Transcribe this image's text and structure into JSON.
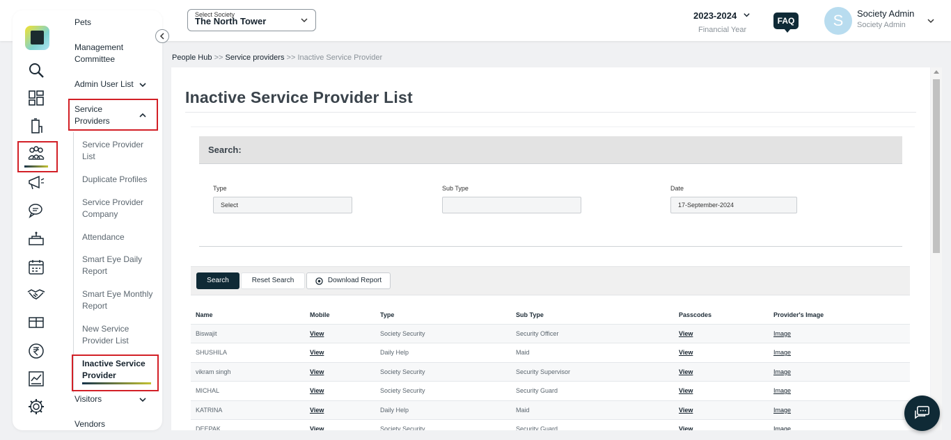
{
  "topbar": {
    "society_label": "Select Society",
    "society_value": "The North Tower",
    "year": "2023-2024",
    "year_caption": "Financial Year",
    "faq": "FAQ",
    "avatar_initial": "S",
    "user_name": "Society Admin",
    "user_role": "Society Admin"
  },
  "sidebar": {
    "rail_icons": [
      "logo",
      "search-icon",
      "dashboard-icon",
      "building-icon",
      "people-hub-icon",
      "megaphone-icon",
      "chat-icon",
      "facility-icon",
      "calendar-icon",
      "handshake-icon",
      "parcel-icon",
      "rupee-icon",
      "report-icon",
      "gear-icon"
    ],
    "items": {
      "pets": "Pets",
      "management": "Management Committee",
      "admin_user_list": "Admin User List",
      "service_providers": "Service Providers",
      "service_provider_list": "Service Provider List",
      "duplicate_profiles": "Duplicate Profiles",
      "service_provider_company": "Service Provider Company",
      "attendance": "Attendance",
      "smart_eye_daily": "Smart Eye Daily Report",
      "smart_eye_monthly": "Smart Eye Monthly Report",
      "new_service_provider": "New Service Provider List",
      "inactive_service_provider": "Inactive Service Provider",
      "visitors": "Visitors",
      "vendors": "Vendors"
    }
  },
  "breadcrumb": {
    "people_hub": "People Hub",
    "sep": ">>",
    "service_providers": "Service providers",
    "current": "Inactive Service Provider"
  },
  "page": {
    "title": "Inactive Service Provider List",
    "search_heading": "Search:",
    "fields": {
      "type_label": "Type",
      "type_value": "Select",
      "subtype_label": "Sub Type",
      "subtype_value": "",
      "date_label": "Date",
      "date_value": "17-September-2024"
    },
    "buttons": {
      "search": "Search",
      "reset": "Reset Search",
      "download": "Download Report"
    }
  },
  "table": {
    "headers": {
      "name": "Name",
      "mobile": "Mobile",
      "type": "Type",
      "sub_type": "Sub Type",
      "passcodes": "Passcodes",
      "image": "Provider's Image"
    },
    "rows": [
      {
        "name": "Biswajit",
        "mobile": "View",
        "type": "Society Security",
        "sub_type": "Security Officer",
        "passcodes": "View",
        "image": "Image"
      },
      {
        "name": "SHUSHILA",
        "mobile": "View",
        "type": "Daily Help",
        "sub_type": "Maid",
        "passcodes": "View",
        "image": "Image"
      },
      {
        "name": "vikram singh",
        "mobile": "View",
        "type": "Society Security",
        "sub_type": "Security Supervisor",
        "passcodes": "View",
        "image": "Image"
      },
      {
        "name": "MICHAL",
        "mobile": "View",
        "type": "Society Security",
        "sub_type": "Security Guard",
        "passcodes": "View",
        "image": "Image"
      },
      {
        "name": "KATRINA",
        "mobile": "View",
        "type": "Daily Help",
        "sub_type": "Maid",
        "passcodes": "View",
        "image": "Image"
      },
      {
        "name": "DEEPAK",
        "mobile": "View",
        "type": "Society Security",
        "sub_type": "Security Guard",
        "passcodes": "View",
        "image": "Image"
      }
    ]
  },
  "colors": {
    "accent_dark": "#0f2a36",
    "highlight_red": "#d21f26",
    "gradient_end": "#c4c232"
  }
}
